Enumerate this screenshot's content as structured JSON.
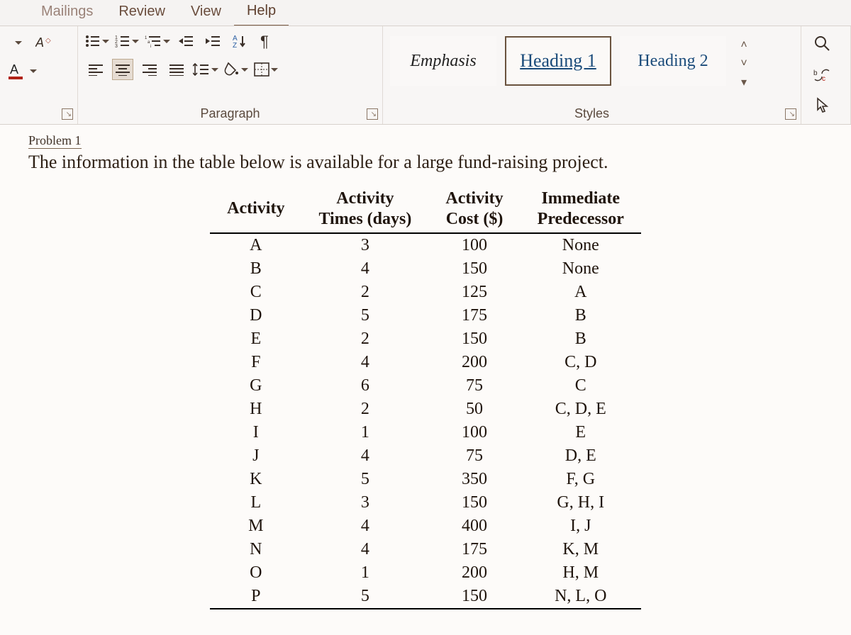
{
  "menu": {
    "mailings": "Mailings",
    "review": "Review",
    "view": "View",
    "help": "Help"
  },
  "ribbon": {
    "paragraph_label": "Paragraph",
    "styles_label": "Styles",
    "styles": {
      "emphasis": "Emphasis",
      "heading1": "Heading 1",
      "heading2": "Heading 2"
    }
  },
  "document": {
    "partial_heading": "Problem 1",
    "intro": "The information in the table below is available for a large fund-raising project.",
    "table": {
      "headers": {
        "activity": "Activity",
        "times": "Activity\nTimes (days)",
        "cost": "Activity\nCost ($)",
        "pred": "Immediate\nPredecessor"
      },
      "rows": [
        {
          "a": "A",
          "t": "3",
          "c": "100",
          "p": "None"
        },
        {
          "a": "B",
          "t": "4",
          "c": "150",
          "p": "None"
        },
        {
          "a": "C",
          "t": "2",
          "c": "125",
          "p": "A"
        },
        {
          "a": "D",
          "t": "5",
          "c": "175",
          "p": "B"
        },
        {
          "a": "E",
          "t": "2",
          "c": "150",
          "p": "B"
        },
        {
          "a": "F",
          "t": "4",
          "c": "200",
          "p": "C, D"
        },
        {
          "a": "G",
          "t": "6",
          "c": "75",
          "p": "C"
        },
        {
          "a": "H",
          "t": "2",
          "c": "50",
          "p": "C, D, E"
        },
        {
          "a": "I",
          "t": "1",
          "c": "100",
          "p": "E"
        },
        {
          "a": "J",
          "t": "4",
          "c": "75",
          "p": "D, E"
        },
        {
          "a": "K",
          "t": "5",
          "c": "350",
          "p": "F, G"
        },
        {
          "a": "L",
          "t": "3",
          "c": "150",
          "p": "G, H, I"
        },
        {
          "a": "M",
          "t": "4",
          "c": "400",
          "p": "I, J"
        },
        {
          "a": "N",
          "t": "4",
          "c": "175",
          "p": "K, M"
        },
        {
          "a": "O",
          "t": "1",
          "c": "200",
          "p": "H, M"
        },
        {
          "a": "P",
          "t": "5",
          "c": "150",
          "p": "N, L, O"
        }
      ]
    }
  }
}
